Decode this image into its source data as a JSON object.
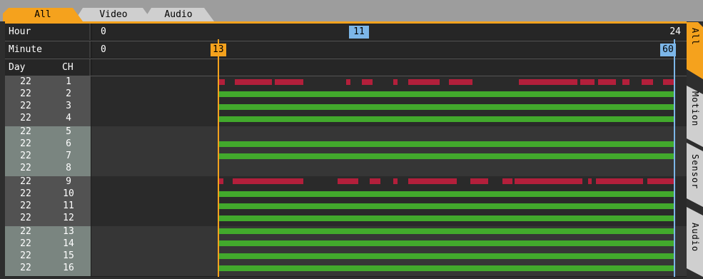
{
  "top_tabs": [
    {
      "label": "All",
      "active": true
    },
    {
      "label": "Video",
      "active": false
    },
    {
      "label": "Audio",
      "active": false
    }
  ],
  "side_tabs": [
    {
      "label": "All",
      "active": true
    },
    {
      "label": "Motion",
      "active": false
    },
    {
      "label": "Sensor",
      "active": false
    },
    {
      "label": "Audio",
      "active": false
    }
  ],
  "header": {
    "hour_label": "Hour",
    "minute_label": "Minute",
    "day_label": "Day",
    "ch_label": "CH",
    "hour_start": "0",
    "hour_end": "24",
    "hour_selected": "11",
    "minute_start": "0",
    "minute_current": "13",
    "minute_end": "60"
  },
  "timeline": {
    "minute_current": 13,
    "minute_end": 60,
    "hour_selected": 11,
    "hours_total": 24
  },
  "channels": [
    {
      "day": "22",
      "ch": "1"
    },
    {
      "day": "22",
      "ch": "2"
    },
    {
      "day": "22",
      "ch": "3"
    },
    {
      "day": "22",
      "ch": "4"
    },
    {
      "day": "22",
      "ch": "5"
    },
    {
      "day": "22",
      "ch": "6"
    },
    {
      "day": "22",
      "ch": "7"
    },
    {
      "day": "22",
      "ch": "8"
    },
    {
      "day": "22",
      "ch": "9"
    },
    {
      "day": "22",
      "ch": "10"
    },
    {
      "day": "22",
      "ch": "11"
    },
    {
      "day": "22",
      "ch": "12"
    },
    {
      "day": "22",
      "ch": "13"
    },
    {
      "day": "22",
      "ch": "14"
    },
    {
      "day": "22",
      "ch": "15"
    },
    {
      "day": "22",
      "ch": "16"
    }
  ],
  "recordings": {
    "colors": {
      "continuous": "#42a92c",
      "event": "#b31f3b",
      "hour_marker": "#7cb6e8",
      "minute_marker": "#f5a21d"
    },
    "continuous_channels": [
      2,
      3,
      4,
      6,
      7,
      10,
      11,
      12,
      13,
      14,
      15,
      16
    ],
    "continuous_minutes": [
      [
        13,
        60
      ]
    ],
    "event_channels": {
      "1": [
        [
          13,
          13.7
        ],
        [
          14.7,
          18.5
        ],
        [
          18.8,
          21.8
        ],
        [
          26.2,
          26.6
        ],
        [
          27.8,
          28.9
        ],
        [
          31.0,
          31.5
        ],
        [
          32.6,
          35.8
        ],
        [
          36.8,
          39.2
        ],
        [
          44.0,
          50.0
        ],
        [
          50.3,
          51.8
        ],
        [
          52.1,
          54.0
        ],
        [
          54.6,
          55.4
        ],
        [
          56.6,
          57.8
        ],
        [
          58.8,
          60
        ]
      ],
      "9": [
        [
          13,
          13.5
        ],
        [
          14.5,
          21.8
        ],
        [
          25.3,
          27.4
        ],
        [
          28.6,
          29.7
        ],
        [
          31.0,
          31.5
        ],
        [
          32.6,
          37.6
        ],
        [
          39.0,
          40.8
        ],
        [
          42.3,
          43.3
        ],
        [
          43.5,
          50.5
        ],
        [
          51.1,
          51.5
        ],
        [
          51.9,
          56.8
        ],
        [
          57.2,
          60
        ]
      ]
    }
  }
}
